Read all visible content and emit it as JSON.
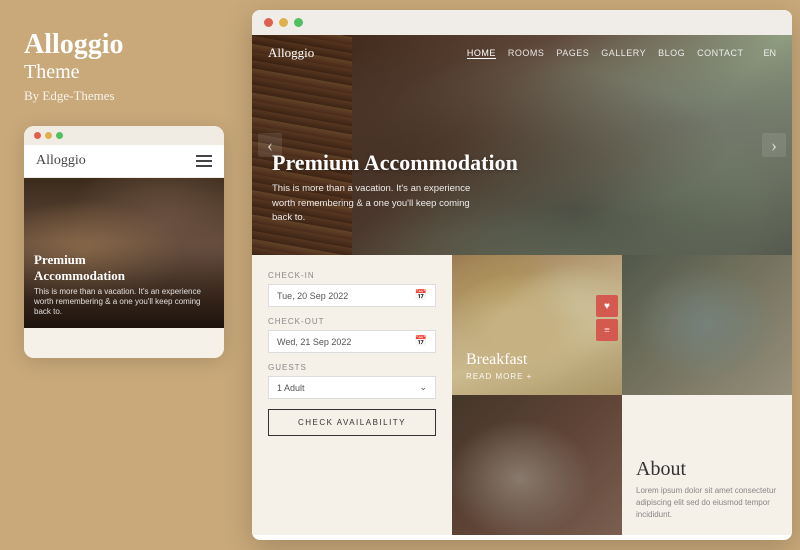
{
  "left": {
    "title": "Alloggio",
    "subtitle": "Theme",
    "author": "By Edge-Themes"
  },
  "mobile": {
    "logo": "Alloggio",
    "hero_title": "Premium\nAccommodation",
    "hero_text": "This is more than a vacation. It's an experience worth remembering & a one you'll keep coming back to."
  },
  "browser": {
    "dots": [
      "red",
      "yellow",
      "green"
    ]
  },
  "site": {
    "logo": "Alloggio",
    "nav": {
      "home": "HOME",
      "rooms": "ROOMS",
      "pages": "PAGES",
      "gallery": "GALLERY",
      "blog": "BLOG",
      "contact": "CONTACT",
      "lang": "EN"
    },
    "hero": {
      "title": "Premium Accommodation",
      "desc": "This is more than a vacation. It's an experience worth remembering & a one you'll keep coming back to."
    },
    "booking": {
      "checkin_label": "CHECK-IN",
      "checkin_value": "Tue, 20 Sep 2022",
      "checkout_label": "CHECK-OUT",
      "checkout_value": "Wed, 21 Sep 2022",
      "guests_label": "GUESTS",
      "guests_value": "1 Adult",
      "button": "CHECK AVAILABILITY"
    },
    "breakfast": {
      "title": "Breakfast",
      "link": "READ MORE +"
    },
    "about": {
      "title": "About",
      "text": "Lorem ipsum dolor sit amet consectetur adipiscing elit sed do eiusmod tempor incididunt."
    }
  }
}
